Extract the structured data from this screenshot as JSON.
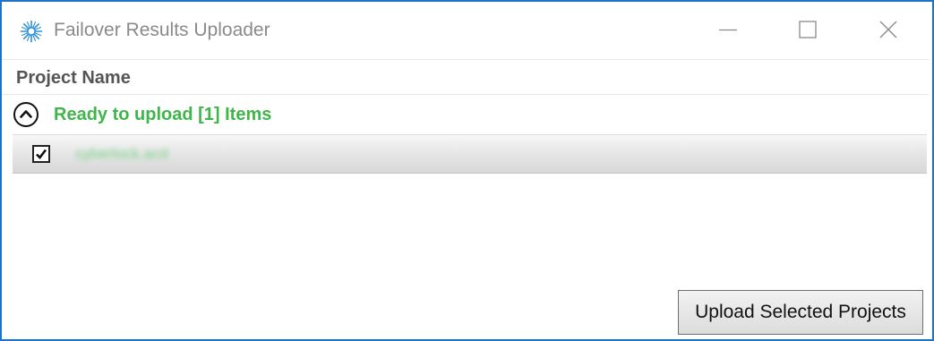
{
  "window": {
    "title": "Failover Results Uploader",
    "app_icon": "agilent-spark-icon",
    "accent_color": "#1e73c8",
    "controls": {
      "minimize": "minimize-icon",
      "maximize": "maximize-icon",
      "close": "close-icon"
    }
  },
  "table": {
    "column_header": "Project Name",
    "groups": [
      {
        "label": "Ready to upload [1] Items",
        "label_color": "#3fb54a",
        "expanded": true,
        "toggle_icon": "chevron-up-circle-icon",
        "items": [
          {
            "checked": true,
            "name": "cyberlock.acd"
          }
        ]
      }
    ]
  },
  "actions": {
    "upload_label": "Upload Selected Projects"
  }
}
